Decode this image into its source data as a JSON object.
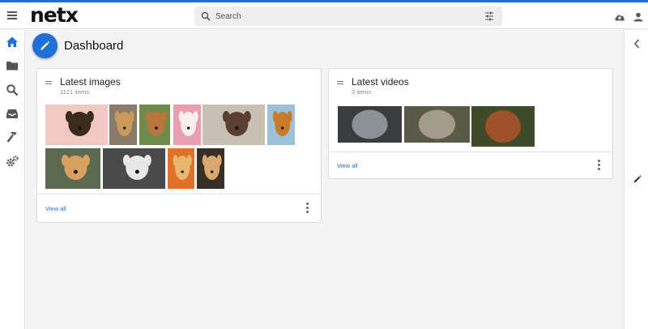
{
  "app": {
    "logo_text": "netx",
    "accent_color": "#1f6fd6",
    "search": {
      "placeholder": "Search"
    },
    "top_icons": [
      "cloud-upload-icon",
      "account-icon"
    ]
  },
  "sidebar": {
    "items": [
      {
        "name": "home",
        "icon": "home-icon",
        "active": true
      },
      {
        "name": "folders",
        "icon": "folder-icon"
      },
      {
        "name": "search",
        "icon": "search-icon"
      },
      {
        "name": "inbox",
        "icon": "inbox-icon"
      },
      {
        "name": "tools",
        "icon": "hammer-icon"
      },
      {
        "name": "settings",
        "icon": "gears-icon"
      }
    ]
  },
  "dashboard": {
    "title": "Dashboard",
    "widgets": {
      "images": {
        "title": "Latest images",
        "count": "1121 items",
        "view_all": "View all",
        "thumbnails": [
          {
            "name": "dog-thumbnail-1",
            "bg": "#f2c8c4",
            "subject": "#3a2a20"
          },
          {
            "name": "dog-thumbnail-2",
            "bg": "#8a7a6a",
            "subject": "#c99a5a"
          },
          {
            "name": "dog-thumbnail-3",
            "bg": "#6f8a4a",
            "subject": "#b8763a"
          },
          {
            "name": "dog-thumbnail-4",
            "bg": "#e8a0b0",
            "subject": "#f5f0ea"
          },
          {
            "name": "dog-thumbnail-5",
            "bg": "#c8c0b4",
            "subject": "#5a4030"
          },
          {
            "name": "dog-thumbnail-6",
            "bg": "#9ec0d8",
            "subject": "#c97a2a"
          },
          {
            "name": "dog-thumbnail-7",
            "bg": "#5a6a50",
            "subject": "#d9a060"
          },
          {
            "name": "dog-thumbnail-8",
            "bg": "#4a4a4a",
            "subject": "#e8e8e8"
          },
          {
            "name": "dog-thumbnail-9",
            "bg": "#e0702a",
            "subject": "#e8b870"
          },
          {
            "name": "dog-thumbnail-10",
            "bg": "#3a2e28",
            "subject": "#d8a870"
          }
        ]
      },
      "videos": {
        "title": "Latest videos",
        "count": "3 items",
        "view_all": "View all",
        "thumbnails": [
          {
            "name": "video-thumbnail-camera-lens",
            "bg": "#3a3d40",
            "subject": "#9aa0a4"
          },
          {
            "name": "video-thumbnail-monkeys",
            "bg": "#5a5a4a",
            "subject": "#b0a898"
          },
          {
            "name": "video-thumbnail-red-panda",
            "bg": "#3e4a2a",
            "subject": "#b0542a"
          }
        ]
      }
    }
  }
}
